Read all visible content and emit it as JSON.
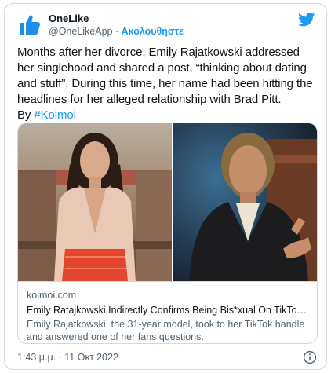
{
  "tweet": {
    "author": {
      "display_name": "OneLike",
      "handle": "@OneLikeApp",
      "separator": " · ",
      "follow_label": "Ακολουθήστε"
    },
    "text_main": "Months after her divorce, Emily Rajatkowski addressed her singlehood and shared a post, “thinking about dating and stuff”. During this time, her name had been hitting the headlines for her alleged relationship with Brad Pitt.",
    "text_by": "By ",
    "hashtag": "#Koimoi",
    "link_card": {
      "domain": "koimoi.com",
      "title": "Emily Ratajkowski Indirectly Confirms Being Bis*xual On TikTok Amid Da...",
      "description": "Emily Rajatkowski, the 31-year model, took to her TikTok handle and answered one of her fans questions."
    },
    "timestamp": "1:43 μ.μ. · 11 Οκτ 2022",
    "colors": {
      "accent": "#1d9bf0",
      "text": "#0f1419",
      "secondary": "#536471",
      "border": "#cfd9de"
    },
    "icons": {
      "avatar": "thumbs-up-logo",
      "brand": "twitter-bird-icon",
      "info": "info-icon"
    }
  }
}
